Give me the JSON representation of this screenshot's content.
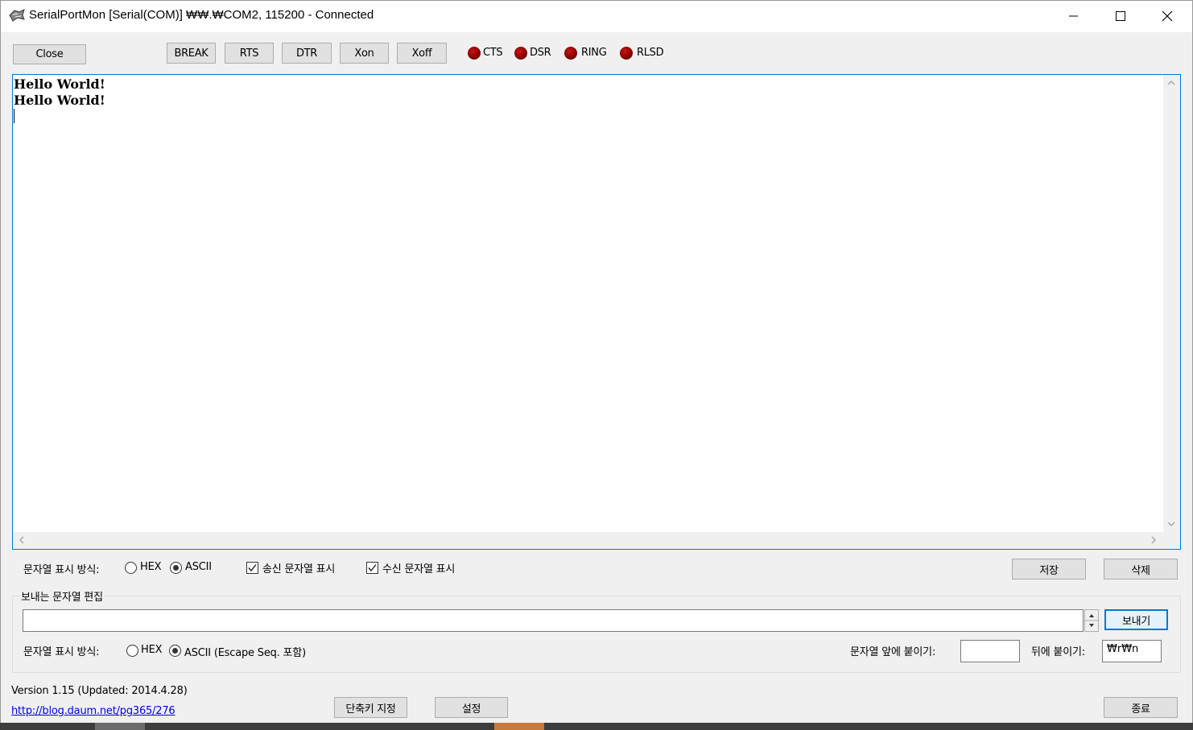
{
  "window": {
    "title": "SerialPortMon [Serial(COM)] ₩₩.₩COM2, 115200 - Connected"
  },
  "toolbar": {
    "close_label": "Close",
    "break_label": "BREAK",
    "rts_label": "RTS",
    "dtr_label": "DTR",
    "xon_label": "Xon",
    "xoff_label": "Xoff"
  },
  "indicators": [
    {
      "label": "CTS",
      "state": "off",
      "color": "#8c0000"
    },
    {
      "label": "DSR",
      "state": "off",
      "color": "#8c0000"
    },
    {
      "label": "RING",
      "state": "off",
      "color": "#8c0000"
    },
    {
      "label": "RLSD",
      "state": "off",
      "color": "#8c0000"
    }
  ],
  "receive": {
    "lines": [
      "Hello World!",
      "Hello World!"
    ],
    "text": "Hello World!\nHello World!"
  },
  "display_options": {
    "mode_label": "문자열 표시 방식:",
    "hex_label": "HEX",
    "ascii_label": "ASCII",
    "selected": "ASCII",
    "show_sent_label": "송신 문자열 표시",
    "show_sent_checked": true,
    "show_received_label": "수신 문자열 표시",
    "show_received_checked": true,
    "save_label": "저장",
    "delete_label": "삭제"
  },
  "send_group": {
    "title": "보내는 문자열 편집",
    "input_value": "",
    "send_label": "보내기",
    "mode_label": "문자열 표시 방식:",
    "hex_label": "HEX",
    "ascii_label": "ASCII (Escape Seq. 포함)",
    "selected": "ASCII",
    "prefix_label": "문자열 앞에 붙이기:",
    "prefix_value": "",
    "suffix_label": "뒤에 붙이기:",
    "suffix_value": "₩r₩n"
  },
  "footer": {
    "version": "Version 1.15 (Updated: 2014.4.28)",
    "link": "http://blog.daum.net/pg365/276",
    "shortcut_label": "단축키 지정",
    "settings_label": "설정",
    "exit_label": "종료"
  },
  "colors": {
    "accent": "#0078d7",
    "led_off": "#8c0000",
    "link": "#0000ee"
  }
}
